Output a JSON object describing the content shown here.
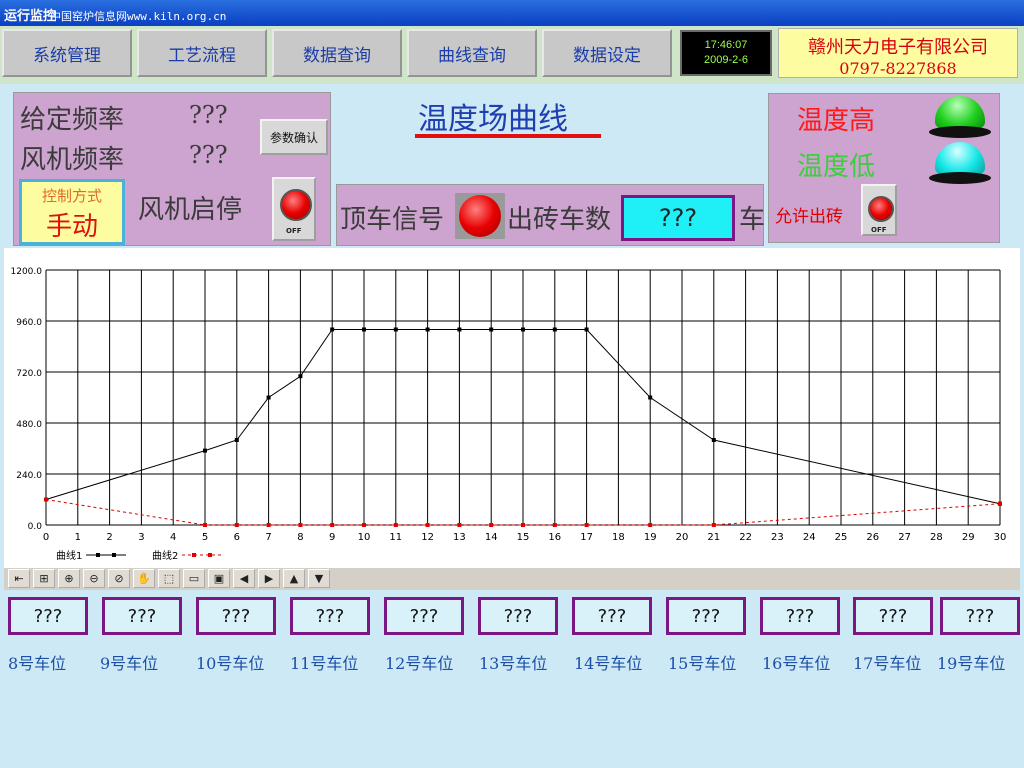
{
  "titlebar": {
    "title": "运行监控",
    "watermark": "中国窑炉信息网www.kiln.org.cn"
  },
  "menu": [
    "系统管理",
    "工艺流程",
    "数据查询",
    "曲线查询",
    "数据设定"
  ],
  "clock": {
    "time": "17:46:07",
    "date": "2009-2-6"
  },
  "company": {
    "name": "赣州天力电子有限公司",
    "phone": "0797-8227868"
  },
  "freq_panel": {
    "given_label": "给定频率",
    "given_value": "???",
    "fan_label": "风机频率",
    "fan_value": "???",
    "confirm_button": "参数确认",
    "mode_label": "控制方式",
    "mode_value": "手动",
    "fan_start_label": "风机启停",
    "off_label": "OFF"
  },
  "heading": "温度场曲线",
  "signal_panel": {
    "push_label": "顶车信号",
    "count_label": "出砖车数",
    "count_value": "???",
    "unit": "车"
  },
  "alarm_panel": {
    "high_label": "温度高",
    "low_label": "温度低",
    "allow_label": "允许出砖",
    "off_label": "OFF"
  },
  "colors": {
    "high": "#ff1a1a",
    "low": "#3dcd3d",
    "high_lamp": "#20d020",
    "low_lamp": "#18e8e8"
  },
  "toolbar_icons": [
    "fit-icon",
    "grid-icon",
    "zoom-in-icon",
    "zoom-out-icon",
    "zoom-reset-icon",
    "pan-hand-icon",
    "select-icon",
    "open-icon",
    "save-icon",
    "left-arrow-icon",
    "right-arrow-icon",
    "up-arrow-icon",
    "down-arrow-icon"
  ],
  "cars": [
    {
      "value": "???",
      "label": "8号车位"
    },
    {
      "value": "???",
      "label": "9号车位"
    },
    {
      "value": "???",
      "label": "10号车位"
    },
    {
      "value": "???",
      "label": "11号车位"
    },
    {
      "value": "???",
      "label": "12号车位"
    },
    {
      "value": "???",
      "label": "13号车位"
    },
    {
      "value": "???",
      "label": "14号车位"
    },
    {
      "value": "???",
      "label": "15号车位"
    },
    {
      "value": "???",
      "label": "16号车位"
    },
    {
      "value": "???",
      "label": "17号车位"
    },
    {
      "value": "???",
      "label": "19号车位"
    }
  ],
  "chart_data": {
    "type": "line",
    "xlim": [
      0,
      30
    ],
    "ylim": [
      0,
      1200
    ],
    "xticks": [
      "0",
      "1",
      "2",
      "3",
      "4",
      "5",
      "6",
      "7",
      "8",
      "9",
      "10",
      "11",
      "12",
      "13",
      "14",
      "15",
      "16",
      "17",
      "18",
      "19",
      "20",
      "21",
      "22",
      "23",
      "24",
      "25",
      "26",
      "27",
      "28",
      "29",
      "30"
    ],
    "yticks": [
      "0.0",
      "240.0",
      "480.0",
      "720.0",
      "960.0",
      "1200.0"
    ],
    "grid": true,
    "legend_position": "bottom-left",
    "series": [
      {
        "name": "曲线1",
        "color": "#000000",
        "style": "solid",
        "x": [
          0,
          5,
          6,
          7,
          8,
          9,
          10,
          11,
          12,
          13,
          14,
          15,
          16,
          17,
          19,
          21,
          30
        ],
        "y": [
          120,
          350,
          400,
          600,
          700,
          920,
          920,
          920,
          920,
          920,
          920,
          920,
          920,
          920,
          600,
          400,
          100
        ]
      },
      {
        "name": "曲线2",
        "color": "#e00000",
        "style": "dashed",
        "x": [
          0,
          5,
          6,
          7,
          8,
          9,
          10,
          11,
          12,
          13,
          14,
          15,
          16,
          17,
          19,
          21,
          30
        ],
        "y": [
          120,
          0,
          0,
          0,
          0,
          0,
          0,
          0,
          0,
          0,
          0,
          0,
          0,
          0,
          0,
          0,
          100
        ]
      }
    ]
  }
}
